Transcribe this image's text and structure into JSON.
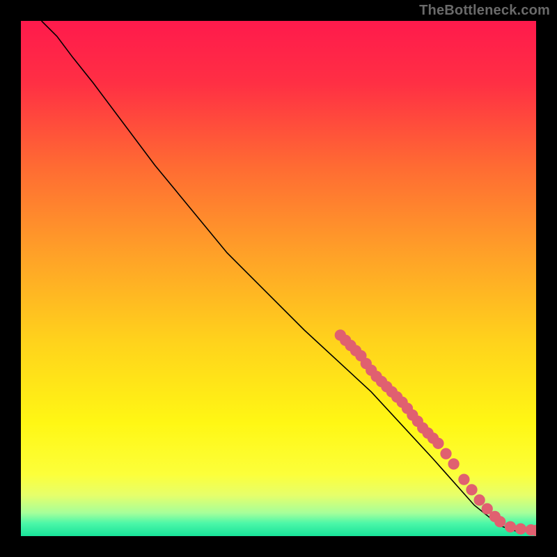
{
  "watermark": "TheBottleneck.com",
  "chart_data": {
    "type": "line",
    "title": "",
    "xlabel": "",
    "ylabel": "",
    "xlim": [
      0,
      100
    ],
    "ylim": [
      0,
      100
    ],
    "background_gradient": {
      "stops": [
        {
          "offset": 0.0,
          "color": "#ff1a4c"
        },
        {
          "offset": 0.12,
          "color": "#ff2f44"
        },
        {
          "offset": 0.28,
          "color": "#ff6a33"
        },
        {
          "offset": 0.45,
          "color": "#ffa028"
        },
        {
          "offset": 0.62,
          "color": "#ffd21c"
        },
        {
          "offset": 0.78,
          "color": "#fff714"
        },
        {
          "offset": 0.88,
          "color": "#fcff3a"
        },
        {
          "offset": 0.92,
          "color": "#e7ff6a"
        },
        {
          "offset": 0.955,
          "color": "#a6ff9a"
        },
        {
          "offset": 0.975,
          "color": "#4cf7a8"
        },
        {
          "offset": 1.0,
          "color": "#18e39a"
        }
      ]
    },
    "curve": [
      {
        "x": 4,
        "y": 100
      },
      {
        "x": 7,
        "y": 97
      },
      {
        "x": 10,
        "y": 93
      },
      {
        "x": 14,
        "y": 88
      },
      {
        "x": 26,
        "y": 72
      },
      {
        "x": 40,
        "y": 55
      },
      {
        "x": 55,
        "y": 40
      },
      {
        "x": 68,
        "y": 28
      },
      {
        "x": 80,
        "y": 15
      },
      {
        "x": 88,
        "y": 6
      },
      {
        "x": 93,
        "y": 2
      },
      {
        "x": 96,
        "y": 1
      },
      {
        "x": 100,
        "y": 1
      }
    ],
    "points": {
      "color": "#e06070",
      "radius": 1.1,
      "xy": [
        [
          62,
          39
        ],
        [
          63,
          38
        ],
        [
          64,
          37
        ],
        [
          65,
          36
        ],
        [
          66,
          35
        ],
        [
          67,
          33.5
        ],
        [
          68,
          32.2
        ],
        [
          69,
          31
        ],
        [
          70,
          30
        ],
        [
          71,
          29
        ],
        [
          72,
          28
        ],
        [
          73,
          27
        ],
        [
          74,
          26
        ],
        [
          75,
          24.8
        ],
        [
          76,
          23.5
        ],
        [
          77,
          22.3
        ],
        [
          78,
          21
        ],
        [
          79,
          20
        ],
        [
          80,
          19
        ],
        [
          81,
          18
        ],
        [
          82.5,
          16
        ],
        [
          84,
          14
        ],
        [
          86,
          11
        ],
        [
          87.5,
          9
        ],
        [
          89,
          7
        ],
        [
          90.5,
          5.3
        ],
        [
          92,
          3.8
        ],
        [
          93,
          2.8
        ],
        [
          95,
          1.8
        ],
        [
          97,
          1.4
        ],
        [
          99,
          1.2
        ],
        [
          100,
          1.1
        ]
      ]
    }
  }
}
